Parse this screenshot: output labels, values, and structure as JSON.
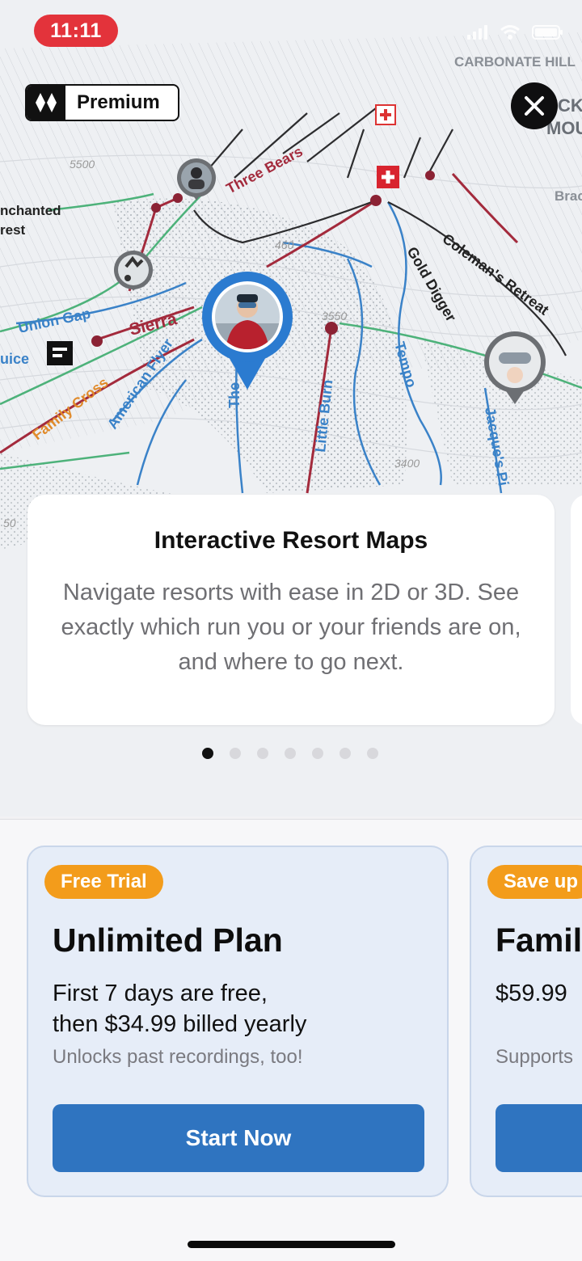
{
  "status_bar": {
    "time": "11:11"
  },
  "premium_badge": {
    "label": "Premium"
  },
  "map": {
    "place_labels": [
      "CARBONATE HILL",
      "CK",
      "MOUNT",
      "Brac",
      "nchanted",
      "rest"
    ],
    "run_labels": [
      "Three Bears",
      "Union Gap",
      "Sierra",
      "uice",
      "American Flyer",
      "Family Cross",
      "The",
      "Little Burn",
      "Tempo",
      "Gold Digger",
      "Coleman's Retreat",
      "Jacque's Pi"
    ],
    "elevation_labels": [
      "3550",
      "3400",
      "460",
      "5500",
      "50"
    ]
  },
  "feature_card": {
    "title": "Interactive Resort Maps",
    "description": "Navigate resorts with ease in 2D or 3D. See exactly which run you or your friends are on, and where to go next."
  },
  "pagination": {
    "count": 7,
    "active": 1
  },
  "plans": [
    {
      "badge": "Free Trial",
      "name": "Unlimited Plan",
      "price_line1": "First 7 days are free,",
      "price_line2": "then $34.99 billed yearly",
      "note": "Unlocks past recordings, too!",
      "cta": "Start Now"
    },
    {
      "badge": "Save up",
      "name": "Famil",
      "price_line1": "$59.99",
      "note": "Supports"
    }
  ],
  "colors": {
    "accent_blue": "#2f74c0",
    "badge_orange": "#f39c1b",
    "status_red": "#e3333b"
  }
}
